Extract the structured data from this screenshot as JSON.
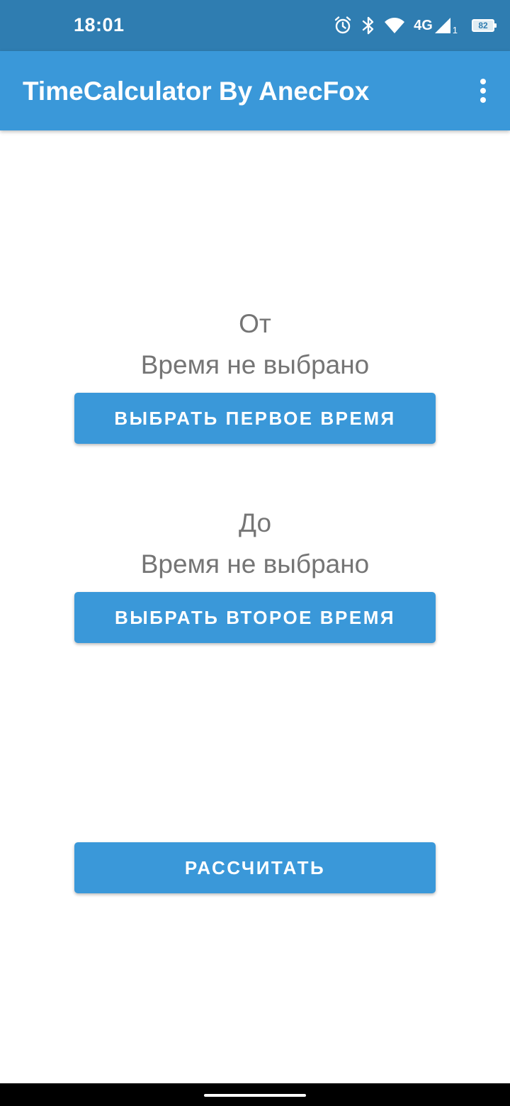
{
  "status_bar": {
    "time": "18:01",
    "network": "4G",
    "sim": "1",
    "battery": "82",
    "icons": [
      "alarm-icon",
      "bluetooth-icon",
      "wifi-icon",
      "signal-icon",
      "battery-icon"
    ]
  },
  "app_bar": {
    "title": "TimeCalculator By AnecFox",
    "menu_icon": "more-vert-icon"
  },
  "from_section": {
    "label": "От",
    "value": "Время не выбрано",
    "button_label": "ВЫБРАТЬ ПЕРВОЕ ВРЕМЯ"
  },
  "to_section": {
    "label": "До",
    "value": "Время не выбрано",
    "button_label": "ВЫБРАТЬ ВТОРОЕ ВРЕМЯ"
  },
  "calculate_button": {
    "label": "РАССЧИТАТЬ"
  },
  "colors": {
    "status_bar": "#2f7db1",
    "primary": "#3a98d9",
    "caption_text": "#757575",
    "nav_bar": "#000000"
  }
}
